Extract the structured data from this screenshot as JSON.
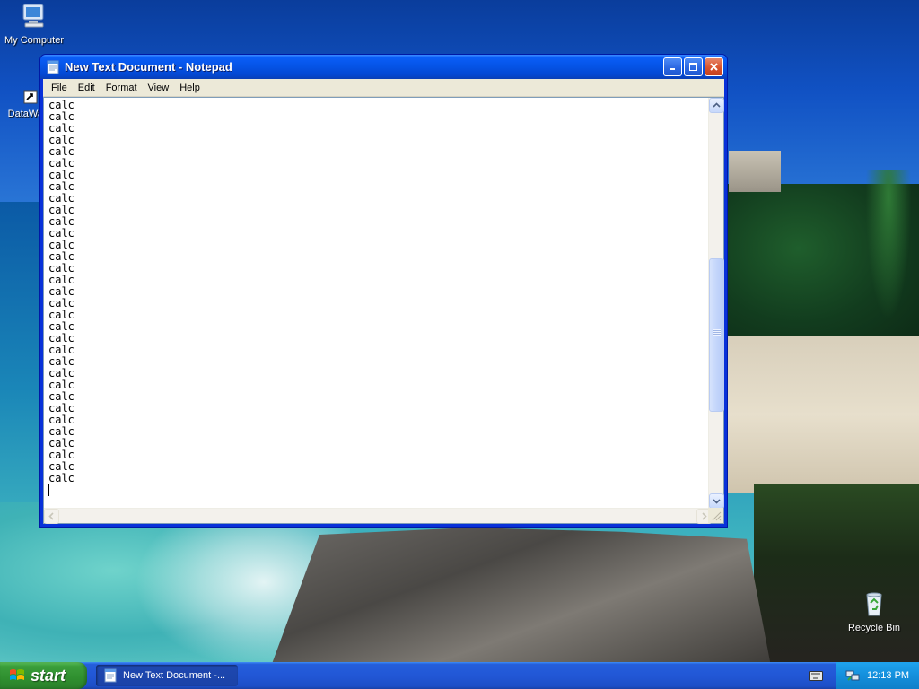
{
  "desktop": {
    "icons": [
      {
        "label": "My Computer",
        "icon": "computer-icon"
      },
      {
        "label": "DataWa",
        "icon": "shortcut-icon"
      },
      {
        "label": "Recycle Bin",
        "icon": "recycle-bin-icon"
      }
    ]
  },
  "window": {
    "title": "New Text Document - Notepad",
    "app_icon": "notepad-icon",
    "caption_buttons": [
      "minimize-icon",
      "maximize-icon",
      "close-icon"
    ],
    "menu": [
      "File",
      "Edit",
      "Format",
      "View",
      "Help"
    ],
    "content_lines": [
      "calc",
      "calc",
      "calc",
      "calc",
      "calc",
      "calc",
      "calc",
      "calc",
      "calc",
      "calc",
      "calc",
      "calc",
      "calc",
      "calc",
      "calc",
      "calc",
      "calc",
      "calc",
      "calc",
      "calc",
      "calc",
      "calc",
      "calc",
      "calc",
      "calc",
      "calc",
      "calc",
      "calc",
      "calc",
      "calc",
      "calc",
      "calc",
      "calc"
    ],
    "vertical_scroll_position": 0.64
  },
  "taskbar": {
    "start_label": "start",
    "tasks": [
      {
        "label": "New Text Document -...",
        "icon": "notepad-icon"
      }
    ],
    "tray_icons": [
      "keyboard-icon",
      "network-icon"
    ],
    "clock": "12:13 PM"
  },
  "colors": {
    "titlebar": "#0553e5",
    "taskbar": "#245edb",
    "start_button": "#3b9e3b",
    "tray": "#148fdc"
  }
}
